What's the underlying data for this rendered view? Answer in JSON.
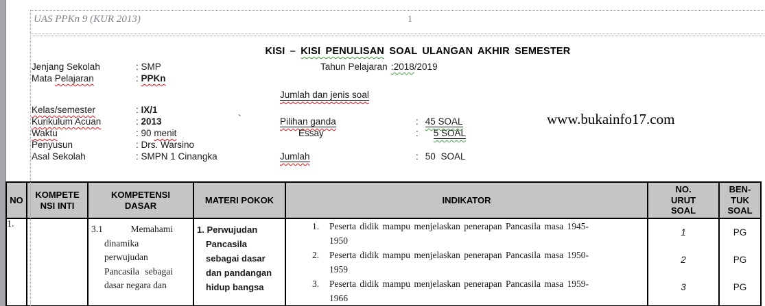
{
  "header": {
    "doc_label": "UAS PPKn 9 (KUR 2013)",
    "page_number": "1"
  },
  "title": {
    "pre": "KISI – ",
    "flagged": "KISI PENULISAN",
    "post": " SOAL ULANGAN AKHIR SEMESTER"
  },
  "tahun": {
    "label": "Tahun Pelajaran",
    "value_flagged": ":2018",
    "value_rest": "/2019"
  },
  "info_left": [
    {
      "label": "Jenjang Sekolah",
      "colon": ":",
      "value": "SMP"
    },
    {
      "label_plain": "Mata ",
      "label_flagged": "Pelajaran",
      "colon": ":",
      "value": "PPKn"
    },
    {
      "label": "Kelas/semester",
      "colon": ":",
      "value": "IX/1"
    },
    {
      "label": "Kurikulum Acuan",
      "colon": ":",
      "value": "2013"
    },
    {
      "label": "Waktu",
      "colon": ":",
      "value_plain": "90 ",
      "value_flagged": "menit"
    },
    {
      "label": "Penyusun",
      "colon": ":",
      "value": "Drs. Warsino"
    },
    {
      "label": "Asal Sekolah",
      "colon": ":",
      "value": "SMPN 1 Cinangka"
    }
  ],
  "jumlah_section": {
    "heading": "Jumlah dan jenis soal",
    "pilihan_label": "Pilihan ganda",
    "pilihan_colon": ":",
    "pilihan_value": "45 SOAL",
    "essay_label": "Essay",
    "essay_colon": ":",
    "essay_value": "5 SOAL",
    "jumlah_label": "Jumlah",
    "jumlah_colon": ":",
    "jumlah_value": "50 SOAL"
  },
  "watermark": "www.bukainfo17.com",
  "stray_char": "`",
  "table": {
    "headers": {
      "no": "NO",
      "kompetensi_inti": "KOMPETE\nNSI INTI",
      "kompetensi_dasar": "KOMPETENSI\nDASAR",
      "materi_pokok": "MATERI POKOK",
      "indikator": "INDIKATOR",
      "no_urut": "NO.\nURUT\nSOAL",
      "bentuk": "BEN-\nTUK\nSOAL"
    },
    "row": {
      "no": "1.",
      "kompetensi_inti": "",
      "kompetensi_dasar": "3.1 Memahami dinamika perwujudan Pancasila sebagai dasar negara dan",
      "materi_pokok": "1. Perwujudan Pancasila sebagai dasar dan pandangan hidup bangsa",
      "indikator_items": [
        {
          "num": "1.",
          "text": "Peserta didik mampu menjelaskan penerapan Pancasila masa 1945-1950"
        },
        {
          "num": "2.",
          "text": "Peserta didik mampu menjelaskan penerapan Pancasila masa 1950-1959"
        },
        {
          "num": "3.",
          "text": "Peserta didik mampu menjelaskan penerapan Pancasila masa 1959-1966"
        }
      ],
      "no_urut": [
        "1",
        "2",
        "3"
      ],
      "bentuk": [
        "PG",
        "PG",
        "PG"
      ]
    }
  },
  "colors": {
    "table_header_bg": "#c5c5c5",
    "spellcheck_red": "#e01010",
    "grammar_green": "#3f9e3f",
    "window_edge_gray": "#a7a7ab"
  }
}
